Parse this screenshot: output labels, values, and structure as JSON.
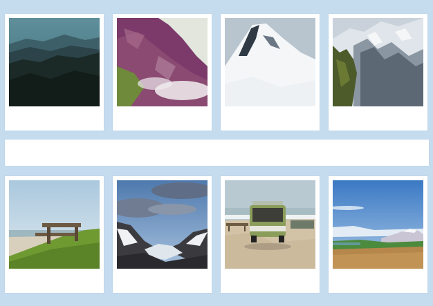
{
  "background_color": "#c5dcef",
  "banner": {
    "text": ""
  },
  "photos": [
    {
      "subject": "misty-forest-hills",
      "caption": ""
    },
    {
      "subject": "purple-rock-cliff-with-clouds",
      "caption": ""
    },
    {
      "subject": "snowy-mountain-peak",
      "caption": ""
    },
    {
      "subject": "snow-covered-alpine-ridge",
      "caption": ""
    },
    {
      "subject": "wooden-bench-on-grassy-coast",
      "caption": ""
    },
    {
      "subject": "glacier-valley-with-clouds",
      "caption": ""
    },
    {
      "subject": "green-camper-van-on-beach",
      "caption": ""
    },
    {
      "subject": "coastal-hills-with-snowy-mountain",
      "caption": ""
    }
  ]
}
